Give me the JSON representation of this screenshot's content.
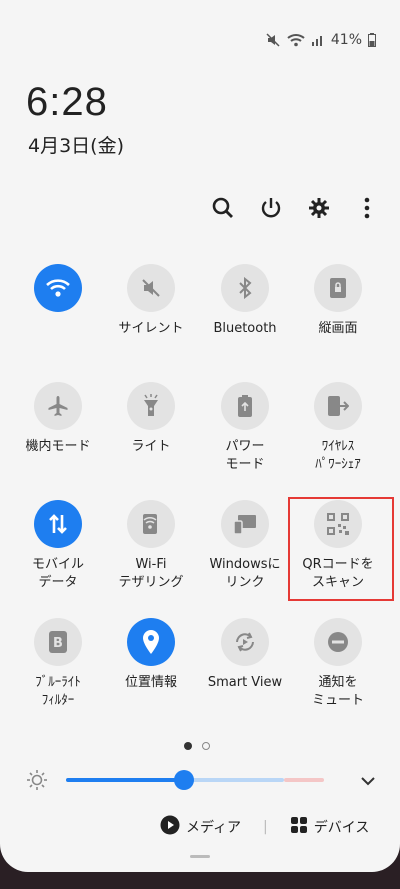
{
  "status": {
    "battery": "41%"
  },
  "clock": {
    "time": "6:28",
    "date": "4月3日(金)"
  },
  "tiles": [
    {
      "label": "",
      "icon": "wifi-icon",
      "active": true
    },
    {
      "label": "サイレント",
      "icon": "silent-icon",
      "active": false
    },
    {
      "label": "Bluetooth",
      "icon": "bluetooth-icon",
      "active": false
    },
    {
      "label": "縦画面",
      "icon": "portrait-icon",
      "active": false
    },
    {
      "label": "機内モード",
      "icon": "airplane-icon",
      "active": false
    },
    {
      "label": "ライト",
      "icon": "flashlight-icon",
      "active": false
    },
    {
      "label": "パワー\nモード",
      "icon": "power-mode-icon",
      "active": false
    },
    {
      "label": "ﾜｲﾔﾚｽ\nﾊﾟﾜｰｼｪｱ",
      "icon": "wireless-share-icon",
      "active": false
    },
    {
      "label": "モバイル\nデータ",
      "icon": "mobile-data-icon",
      "active": true
    },
    {
      "label": "Wi-Fi\nテザリング",
      "icon": "tethering-icon",
      "active": false
    },
    {
      "label": "Windowsに\nリンク",
      "icon": "link-windows-icon",
      "active": false
    },
    {
      "label": "QRコードを\nスキャン",
      "icon": "qr-code-icon",
      "active": false
    },
    {
      "label": "ﾌﾞﾙｰﾗｲﾄ\nﾌｨﾙﾀｰ",
      "icon": "blue-light-icon",
      "active": false
    },
    {
      "label": "位置情報",
      "icon": "location-icon",
      "active": true
    },
    {
      "label": "Smart View",
      "icon": "smart-view-icon",
      "active": false
    },
    {
      "label": "通知を\nミュート",
      "icon": "mute-notification-icon",
      "active": false
    }
  ],
  "brightness": {
    "level": 0.38
  },
  "bottom": {
    "media": "メディア",
    "devices": "デバイス"
  },
  "colors": {
    "accent": "#1e7ef0",
    "highlight": "#e53935"
  }
}
